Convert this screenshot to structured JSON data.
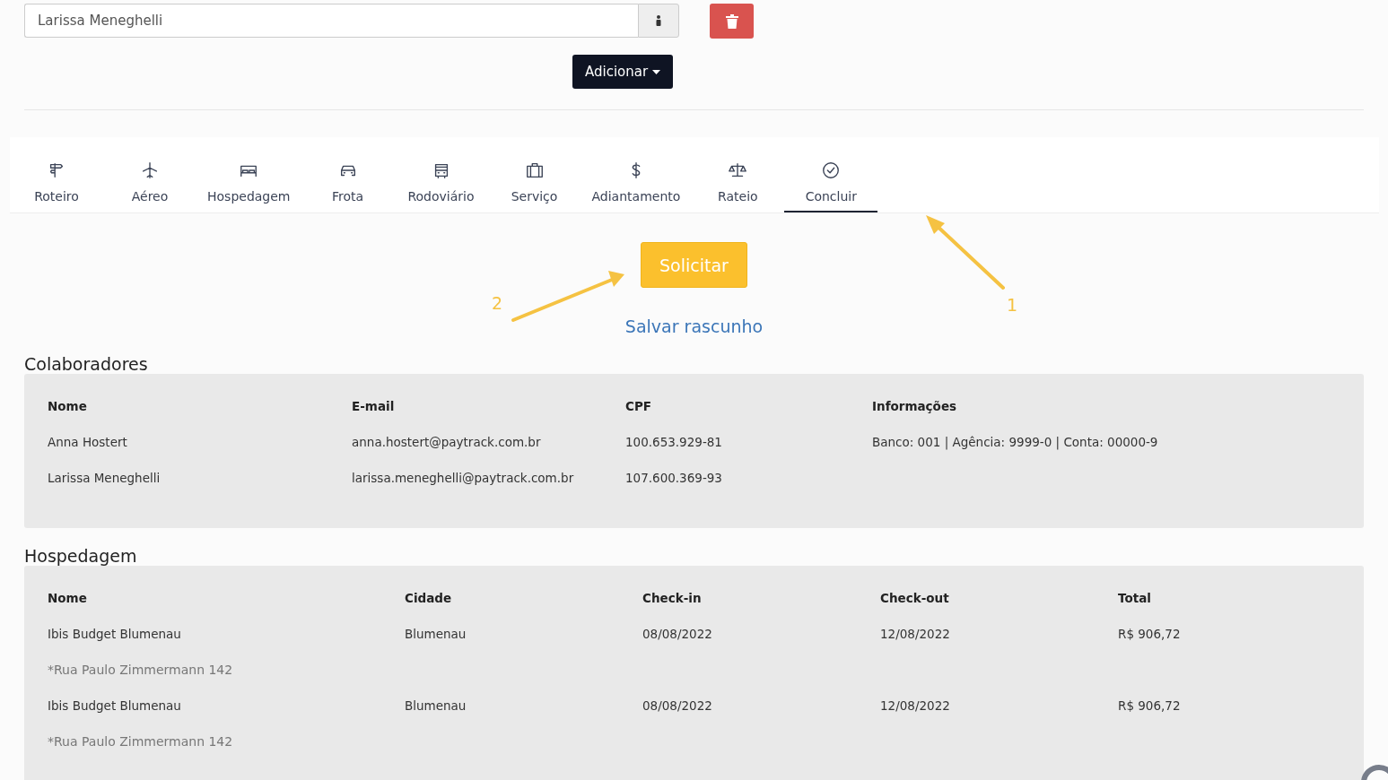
{
  "participant_field": {
    "value": "Larissa Meneghelli"
  },
  "add_button": {
    "label": "Adicionar"
  },
  "tabs": [
    {
      "label": "Roteiro",
      "selected": false
    },
    {
      "label": "Aéreo",
      "selected": false
    },
    {
      "label": "Hospedagem",
      "selected": false
    },
    {
      "label": "Frota",
      "selected": false
    },
    {
      "label": "Rodoviário",
      "selected": false
    },
    {
      "label": "Serviço",
      "selected": false
    },
    {
      "label": "Adiantamento",
      "selected": false
    },
    {
      "label": "Rateio",
      "selected": false
    },
    {
      "label": "Concluir",
      "selected": true
    }
  ],
  "submit_button": {
    "label": "Solicitar"
  },
  "draft_link": {
    "label": "Salvar rascunho"
  },
  "annotations": [
    {
      "label": "2"
    },
    {
      "label": "1"
    }
  ],
  "collaborators": {
    "title": "Colaboradores",
    "columns": [
      "Nome",
      "E-mail",
      "CPF",
      "Informações"
    ],
    "rows": [
      [
        "Anna Hostert",
        "anna.hostert@paytrack.com.br",
        "100.653.929-81",
        "Banco: 001  |  Agência: 9999-0  |  Conta: 00000-9"
      ],
      [
        "Larissa Meneghelli",
        "larissa.meneghelli@paytrack.com.br",
        "107.600.369-93"
      ]
    ]
  },
  "lodging": {
    "title": "Hospedagem",
    "columns": [
      "Nome",
      "Cidade",
      "Check-in",
      "Check-out",
      "Total"
    ],
    "rows": [
      {
        "cells": [
          "Ibis Budget Blumenau",
          "Blumenau",
          "08/08/2022",
          "12/08/2022",
          "R$ 906,72"
        ],
        "address": "*Rua Paulo Zimmermann 142"
      },
      {
        "cells": [
          "Ibis Budget Blumenau",
          "Blumenau",
          "08/08/2022",
          "12/08/2022",
          "R$ 906,72"
        ],
        "address": "*Rua Paulo Zimmermann 142"
      }
    ]
  }
}
